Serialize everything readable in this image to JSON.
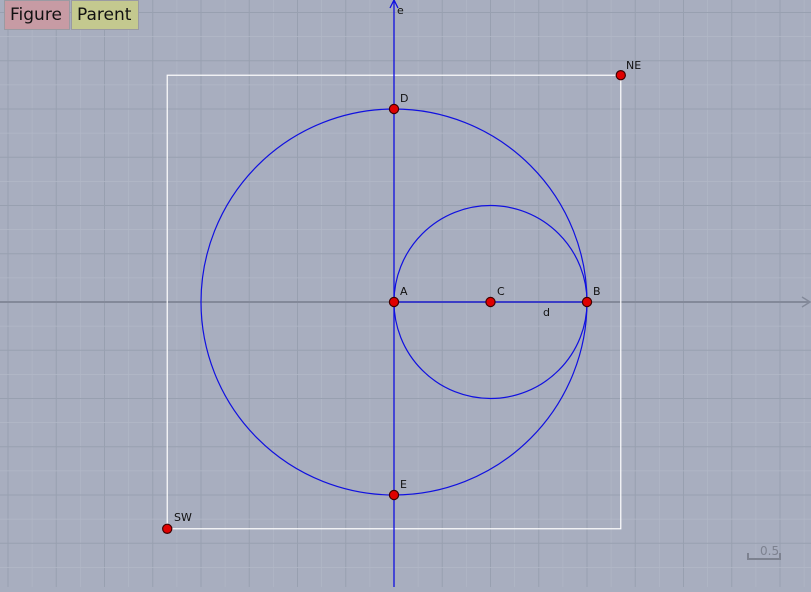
{
  "toolbar": {
    "figure_label": "Figure",
    "figure_color": "#c79ba4",
    "parent_label": "Parent",
    "parent_color": "#c4c98f"
  },
  "colors": {
    "background": "#a8aebf",
    "grid_minor": "#b2b8c7",
    "grid_major": "#98a0b0",
    "axis": "#838999",
    "construction": "#1010e0",
    "frame": "#ffffff",
    "point_fill": "#e00000",
    "point_stroke": "#400000"
  },
  "figure": {
    "units_per_grid": 0.5,
    "points": [
      {
        "name": "A",
        "x": 0,
        "y": 0
      },
      {
        "name": "B",
        "x": 2,
        "y": 0
      },
      {
        "name": "C",
        "x": 1,
        "y": 0
      },
      {
        "name": "D",
        "x": 0,
        "y": 2
      },
      {
        "name": "E",
        "x": 0,
        "y": -2
      },
      {
        "name": "NE",
        "x": 2.35,
        "y": 2.35
      },
      {
        "name": "SW",
        "x": -2.35,
        "y": -2.35
      }
    ],
    "circles": [
      {
        "center": "A",
        "radius": 2
      },
      {
        "center": "C",
        "radius": 1
      }
    ],
    "segments": [
      {
        "name": "d",
        "from": "A",
        "to": "B"
      }
    ],
    "lines": [
      {
        "name": "e",
        "direction": "vertical",
        "through": "A"
      }
    ],
    "frame": {
      "corner_ne": "NE",
      "corner_sw": "SW"
    }
  },
  "labels": {
    "A": "A",
    "B": "B",
    "C": "C",
    "D": "D",
    "E": "E",
    "NE": "NE",
    "SW": "SW",
    "d": "d",
    "e": "e"
  },
  "scale_bar": {
    "value": "0.5"
  }
}
